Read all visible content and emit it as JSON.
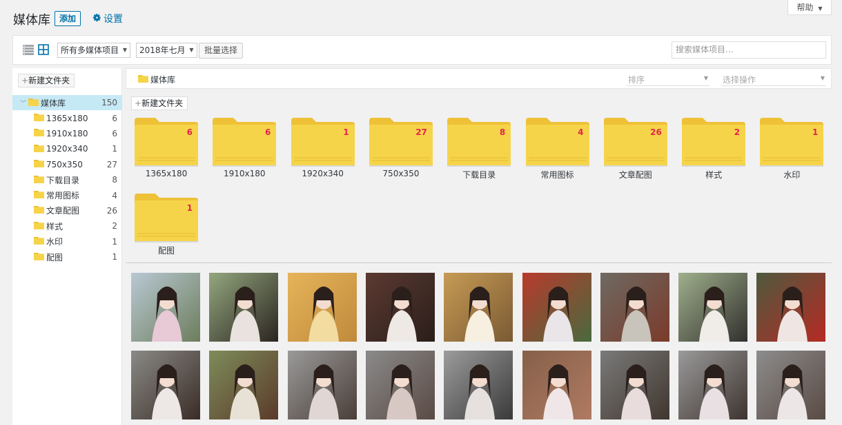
{
  "header": {
    "title": "媒体库",
    "add_label": "添加",
    "settings_label": "设置",
    "help_label": "帮助"
  },
  "toolbar": {
    "filter_type": "所有多媒体项目",
    "filter_date": "2018年七月",
    "bulk_select_label": "批量选择",
    "search_placeholder": "搜索媒体项目..."
  },
  "sidebar": {
    "new_folder_label": "新建文件夹",
    "root": {
      "label": "媒体库",
      "count": "150"
    },
    "folders": [
      {
        "label": "1365x180",
        "count": "6"
      },
      {
        "label": "1910x180",
        "count": "6"
      },
      {
        "label": "1920x340",
        "count": "1"
      },
      {
        "label": "750x350",
        "count": "27"
      },
      {
        "label": "下载目录",
        "count": "8"
      },
      {
        "label": "常用图标",
        "count": "4"
      },
      {
        "label": "文章配图",
        "count": "26"
      },
      {
        "label": "样式",
        "count": "2"
      },
      {
        "label": "水印",
        "count": "1"
      },
      {
        "label": "配图",
        "count": "1"
      }
    ]
  },
  "main": {
    "breadcrumb": "媒体库",
    "sort_placeholder": "排序",
    "action_placeholder": "选择操作",
    "new_folder_label": "新建文件夹",
    "folder_tiles": [
      {
        "label": "1365x180",
        "count": "6"
      },
      {
        "label": "1910x180",
        "count": "6"
      },
      {
        "label": "1920x340",
        "count": "1"
      },
      {
        "label": "750x350",
        "count": "27"
      },
      {
        "label": "下载目录",
        "count": "8"
      },
      {
        "label": "常用图标",
        "count": "4"
      },
      {
        "label": "文章配图",
        "count": "26"
      },
      {
        "label": "样式",
        "count": "2"
      },
      {
        "label": "水印",
        "count": "1"
      },
      {
        "label": "配图",
        "count": "1"
      }
    ]
  },
  "colors": {
    "accent": "#0073aa",
    "folder": "#f6d44a",
    "folder_tab": "#eec137",
    "count_red": "#e2254b",
    "selected_row": "#c6e9f6"
  }
}
